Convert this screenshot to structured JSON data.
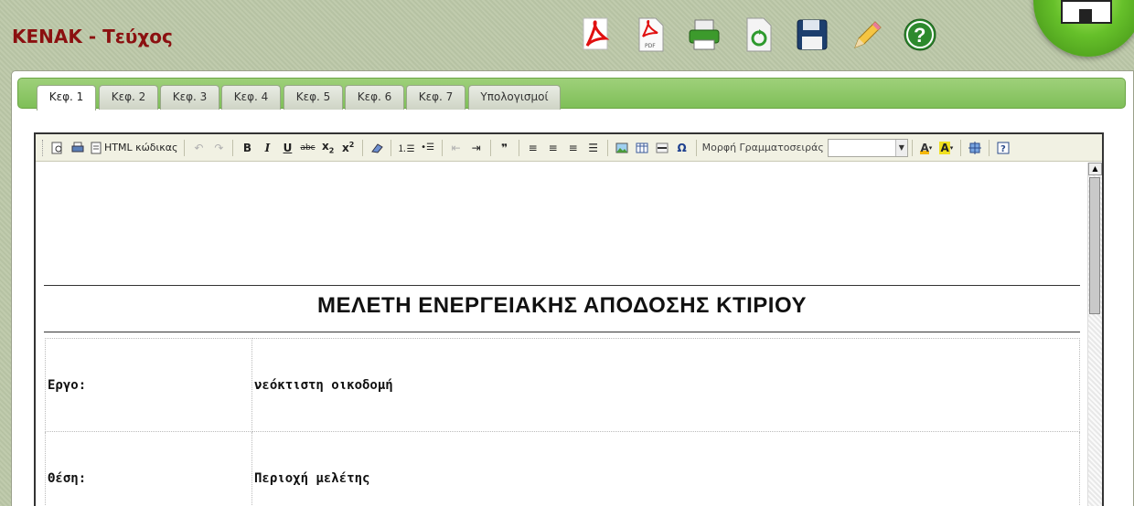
{
  "app": {
    "title": "ΚΕΝΑΚ - Τεύχος"
  },
  "header_icons": [
    {
      "name": "acrobat-icon"
    },
    {
      "name": "pdf-file-icon",
      "label": "PDF"
    },
    {
      "name": "printer-icon"
    },
    {
      "name": "recycle-icon"
    },
    {
      "name": "save-icon"
    },
    {
      "name": "pencil-icon"
    },
    {
      "name": "help-icon"
    }
  ],
  "tabs": [
    {
      "label": "Κεφ. 1",
      "active": true
    },
    {
      "label": "Κεφ. 2"
    },
    {
      "label": "Κεφ. 3"
    },
    {
      "label": "Κεφ. 4"
    },
    {
      "label": "Κεφ. 5"
    },
    {
      "label": "Κεφ. 6"
    },
    {
      "label": "Κεφ. 7"
    },
    {
      "label": "Υπολογισμοί"
    }
  ],
  "editor_toolbar": {
    "html_source_label": "HTML κώδικας",
    "strike_label": "abc",
    "font_label": "Μορφή Γραμματοσειράς",
    "font_value": ""
  },
  "document": {
    "title": "ΜΕΛΕΤΗ ΕΝΕΡΓΕΙΑΚΗΣ ΑΠΟΔΟΣΗΣ ΚΤΙΡΙΟΥ",
    "rows": [
      {
        "label": "Εργο:",
        "value": "νεόκτιστη οικοδομή"
      },
      {
        "label": "Θέση:",
        "value": "Περιοχή μελέτης"
      }
    ]
  },
  "colors": {
    "title_red": "#8b1010",
    "tab_bar_green": "#8cc866",
    "background": "#bcc8a8"
  }
}
